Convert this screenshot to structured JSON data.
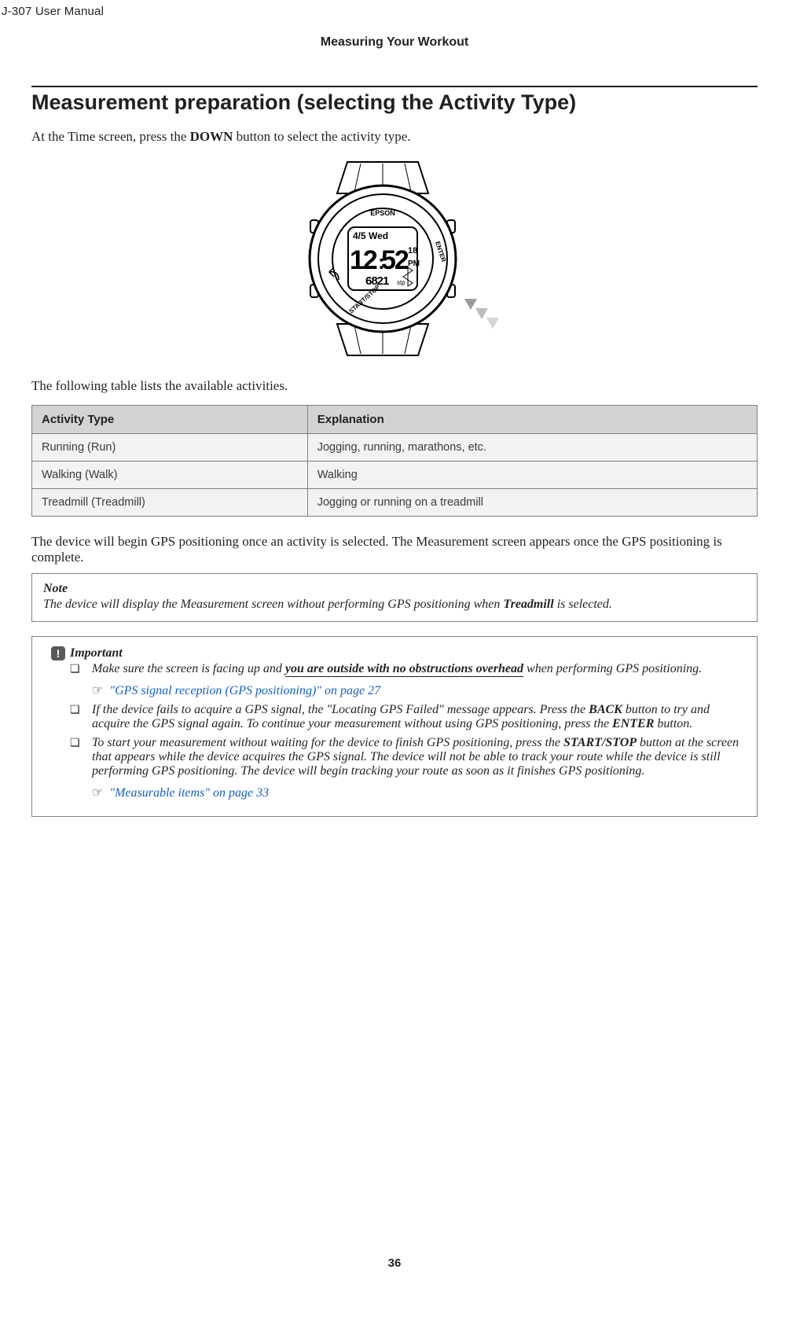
{
  "header": {
    "doc_title": "J-307     User Manual",
    "chapter": "Measuring Your Workout",
    "section_title": "Measurement preparation (selecting the Activity Type)"
  },
  "intro": {
    "line1_pre": "At the Time screen, press the ",
    "down_btn": "DOWN",
    "line1_post": " button to select the activity type.",
    "table_intro": "The following table lists the available activities."
  },
  "watch": {
    "brand": "EPSON",
    "date_line": "4/5 Wed",
    "time_hh": "12",
    "time_mm": "52",
    "time_ss": "18",
    "ampm": "PM",
    "steps": "6821",
    "steps_unit": "stp",
    "btn_enter": "ENTER",
    "btn_start": "START/STOP"
  },
  "table": {
    "col1_header": "Activity Type",
    "col2_header": "Explanation",
    "rows": [
      {
        "type": "Running (Run)",
        "exp": "Jogging, running, marathons, etc."
      },
      {
        "type": "Walking (Walk)",
        "exp": "Walking"
      },
      {
        "type": "Treadmill (Treadmill)",
        "exp": "Jogging or running on a treadmill"
      }
    ]
  },
  "after_table": {
    "text": "The device will begin GPS positioning once an activity is selected. The Measurement screen appears once the GPS positioning is complete."
  },
  "note": {
    "title": "Note",
    "body_pre": "The device will display the Measurement screen without performing GPS positioning when ",
    "treadmill": "Treadmill",
    "body_post": " is selected."
  },
  "important": {
    "title": "Important",
    "icon_glyph": "!",
    "items": [
      {
        "pre": "Make sure the screen is facing up and ",
        "underline": "you are outside with no obstructions overhead",
        "post": " when performing GPS positioning.",
        "ref_text": "\"GPS signal reception (GPS positioning)\" on page 27"
      },
      {
        "pre": "If the device fails to acquire a GPS signal, the \"Locating GPS Failed\" message appears. Press the ",
        "strong1": "BACK",
        "mid1": " button to try and acquire the GPS signal again. To continue your measurement without using GPS positioning, press the ",
        "strong2": "ENTER",
        "post": " button."
      },
      {
        "pre": "To start your measurement without waiting for the device to finish GPS positioning, press the ",
        "strong1": "START/STOP",
        "mid1": " button at the screen that appears while the device acquires the GPS signal. The device will not be able to track your route while the device is still performing GPS positioning. The device will begin tracking your route as soon as it finishes GPS positioning.",
        "ref_text": "\"Measurable items\" on page 33"
      }
    ],
    "hand_glyph": "☞"
  },
  "page_number": "36"
}
